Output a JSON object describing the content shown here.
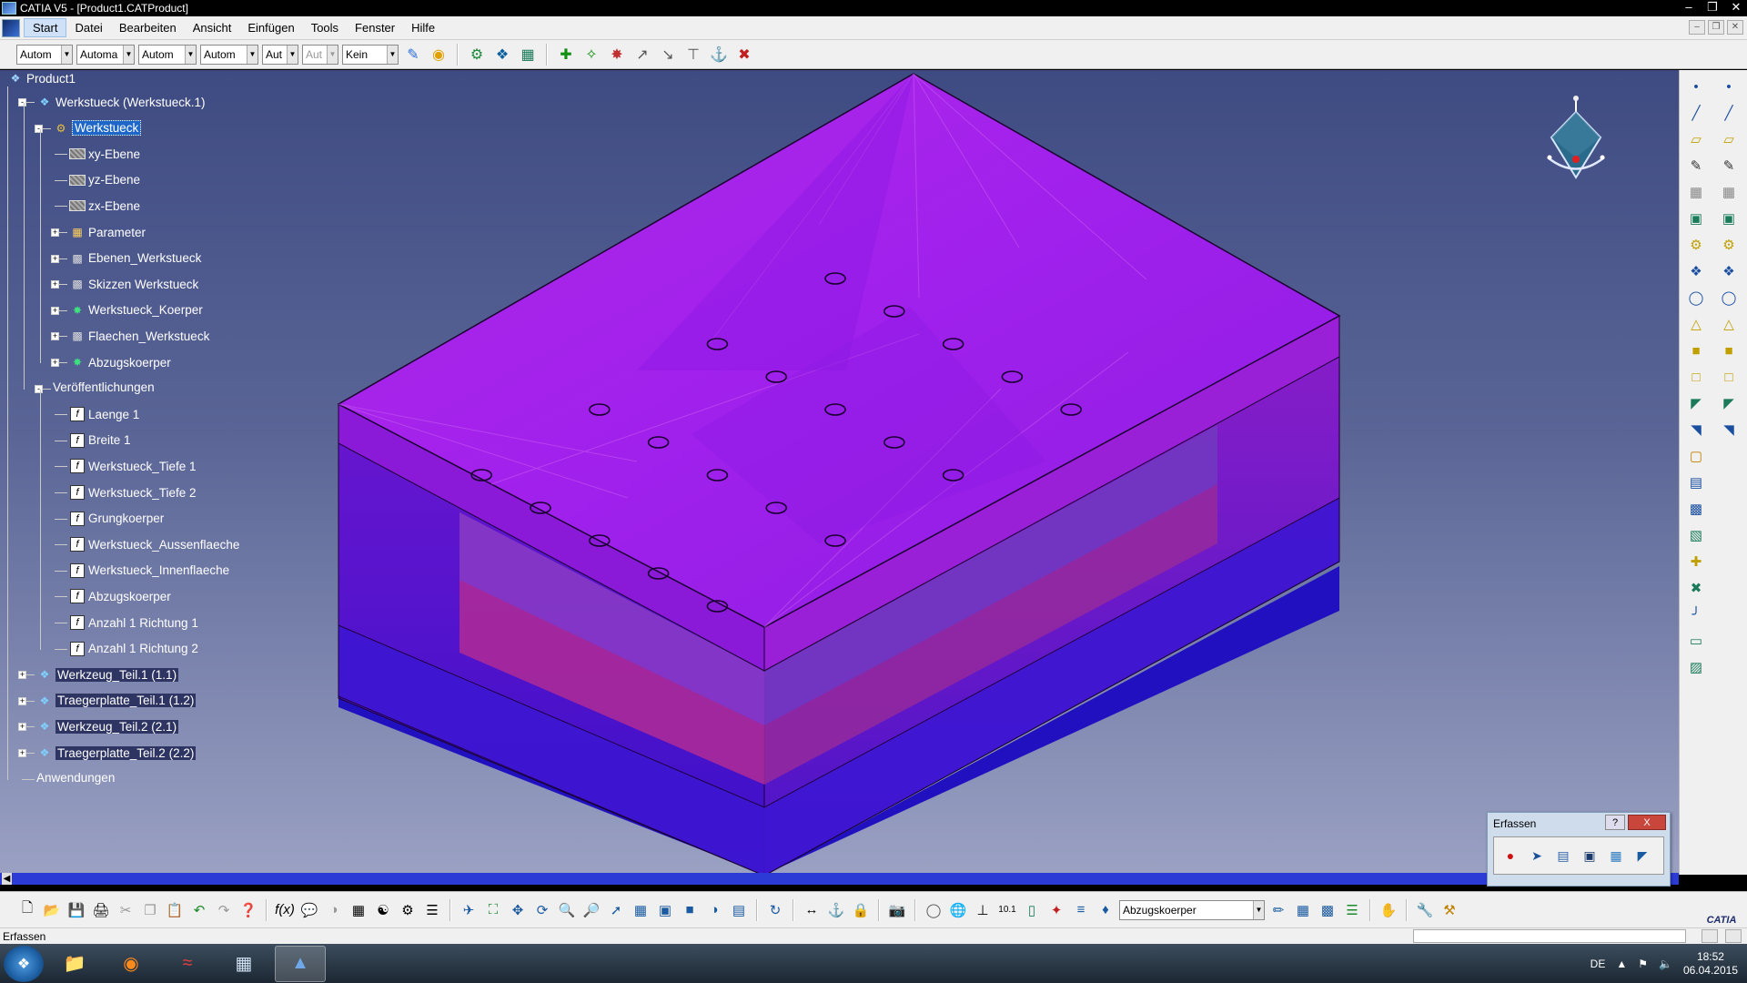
{
  "window": {
    "title": "CATIA V5 - [Product1.CATProduct]",
    "controls": [
      "minimize",
      "restore",
      "close"
    ]
  },
  "menu": {
    "items": [
      {
        "label": "Start",
        "active": true
      },
      {
        "label": "Datei"
      },
      {
        "label": "Bearbeiten"
      },
      {
        "label": "Ansicht"
      },
      {
        "label": "Einfügen"
      },
      {
        "label": "Tools"
      },
      {
        "label": "Fenster"
      },
      {
        "label": "Hilfe"
      }
    ]
  },
  "toolbar_top": {
    "combos": [
      {
        "value": "Autom",
        "width": 58
      },
      {
        "value": "Automa",
        "width": 64
      },
      {
        "value": "Autom",
        "width": 64
      },
      {
        "value": "Autom",
        "width": 64
      },
      {
        "value": "Aut",
        "width": 40
      },
      {
        "value": "Aut",
        "width": 40,
        "disabled": true
      },
      {
        "value": "Kein",
        "width": 62
      }
    ],
    "icons": [
      "paint-brush-icon",
      "graphic-properties-icon",
      "catalog-icon",
      "product-structure-icon",
      "properties-icon",
      "manipulate-icon",
      "snap-icon",
      "explode-icon",
      "clash-icon",
      "distance-icon",
      "section-icon",
      "constraint-icon",
      "analysis-icon"
    ]
  },
  "tree": {
    "root": "Product1",
    "nodes": [
      {
        "label": "Werkstueck (Werkstueck.1)",
        "icon": "part-instance-icon"
      },
      {
        "label": "Werkstueck",
        "icon": "part-icon",
        "selected": true
      },
      {
        "label": "xy-Ebene",
        "icon": "plane-icon"
      },
      {
        "label": "yz-Ebene",
        "icon": "plane-icon"
      },
      {
        "label": "zx-Ebene",
        "icon": "plane-icon"
      },
      {
        "label": "Parameter",
        "icon": "parameter-icon"
      },
      {
        "label": "Ebenen_Werkstueck",
        "icon": "geometric-set-icon"
      },
      {
        "label": "Skizzen Werkstueck",
        "icon": "geometric-set-icon"
      },
      {
        "label": "Werkstueck_Koerper",
        "icon": "body-icon"
      },
      {
        "label": "Flaechen_Werkstueck",
        "icon": "geometric-set-icon"
      },
      {
        "label": "Abzugskoerper",
        "icon": "body-icon"
      },
      {
        "label": "Veröffentlichungen",
        "icon": "none"
      },
      {
        "label": "Laenge 1",
        "icon": "publication-icon"
      },
      {
        "label": "Breite 1",
        "icon": "publication-icon"
      },
      {
        "label": "Werkstueck_Tiefe 1",
        "icon": "publication-icon"
      },
      {
        "label": "Werkstueck_Tiefe 2",
        "icon": "publication-icon"
      },
      {
        "label": "Grungkoerper",
        "icon": "publication-icon"
      },
      {
        "label": "Werkstueck_Aussenflaeche",
        "icon": "publication-icon"
      },
      {
        "label": "Werkstueck_Innenflaeche",
        "icon": "publication-icon"
      },
      {
        "label": "Abzugskoerper",
        "icon": "publication-icon"
      },
      {
        "label": "Anzahl 1 Richtung 1",
        "icon": "publication-icon"
      },
      {
        "label": "Anzahl 1 Richtung 2",
        "icon": "publication-icon"
      },
      {
        "label": "Werkzeug_Teil.1 (1.1)",
        "icon": "part-instance-icon"
      },
      {
        "label": "Traegerplatte_Teil.1 (1.2)",
        "icon": "part-instance-icon"
      },
      {
        "label": "Werkzeug_Teil.2 (2.1)",
        "icon": "part-instance-icon"
      },
      {
        "label": "Traegerplatte_Teil.2 (2.2)",
        "icon": "part-instance-icon"
      },
      {
        "label": "Anwendungen",
        "icon": "none"
      }
    ]
  },
  "model": {
    "colors": {
      "top": "#b026e8",
      "side_front": "#5a12d6",
      "side_right": "#7a1bd0",
      "inner_block": "#c03a8a",
      "base": "#3a18d8",
      "edge": "#1a0030"
    },
    "hole_count": 20
  },
  "erfassen": {
    "title": "Erfassen",
    "help": "?",
    "close": "X",
    "icons": [
      "record-icon",
      "select-icon",
      "capture-options-icon",
      "album-icon",
      "image-icon",
      "chart-icon"
    ]
  },
  "toolbar_bottom": {
    "combo_value": "Abzugskoerper"
  },
  "status": {
    "text": "Erfassen"
  },
  "taskbar": {
    "lang": "DE",
    "time": "18:52",
    "date": "06.04.2015",
    "apps": [
      "explorer-icon",
      "firefox-icon",
      "network-icon",
      "calculator-icon",
      "catia-icon"
    ]
  }
}
